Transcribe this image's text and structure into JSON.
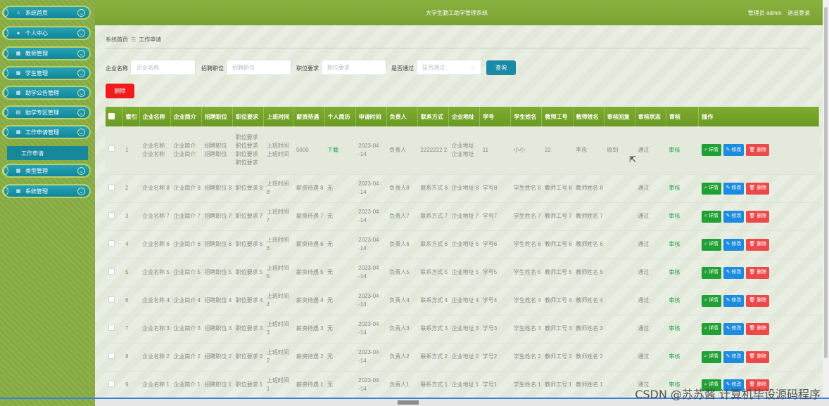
{
  "app": {
    "title": "大学生勤工助学管理系统",
    "user": "管理员 admin",
    "logout": "退出登录"
  },
  "sidebar": {
    "items": [
      {
        "label": "系统首页",
        "icon": "home-icon"
      },
      {
        "label": "个人中心",
        "icon": "user-icon"
      },
      {
        "label": "教师管理",
        "icon": "grid-icon"
      },
      {
        "label": "学生管理",
        "icon": "grid-icon"
      },
      {
        "label": "助学公告管理",
        "icon": "grid-icon"
      },
      {
        "label": "助学专区管理",
        "icon": "calendar-icon"
      },
      {
        "label": "工作申请管理",
        "icon": "grid-icon"
      },
      {
        "label": "类型管理",
        "icon": "grid-icon"
      },
      {
        "label": "系统管理",
        "icon": "grid-icon"
      }
    ],
    "sub_item": "工作申请"
  },
  "breadcrumb": {
    "home": "系统首页",
    "sep": "☰",
    "current": "工作申请"
  },
  "search": {
    "company_label": "企业名称",
    "company_placeholder": "企业名称",
    "job_label": "招聘职位",
    "job_placeholder": "招聘职位",
    "req_label": "职位要求",
    "req_placeholder": "职位要求",
    "pass_label": "是否通过",
    "pass_placeholder": "是否通过",
    "query_button": "查询"
  },
  "toolbar": {
    "delete_button": "删除"
  },
  "table": {
    "headers": [
      "",
      "索引",
      "企业名称",
      "企业简介",
      "招聘职位",
      "职位要求",
      "上班时间",
      "薪资待遇",
      "个人简历",
      "申请时间",
      "负责人",
      "联系方式",
      "企业地址",
      "学号",
      "学生姓名",
      "教师工号",
      "教师姓名",
      "审核回复",
      "审核状态",
      "审核",
      "操作"
    ],
    "ops": {
      "detail": "详情",
      "edit": "修改",
      "delete": "删除"
    },
    "rows": [
      {
        "idx": "1",
        "company": "企业名称 企业名称",
        "intro": "企业简介 企业简介",
        "job": "招聘职位 招聘职位",
        "req": "职位要求 职位要求 职位要求 职位要求",
        "time": "上班时间 上班时间",
        "salary": "5000",
        "resume": "下载",
        "apply": "2023-04 -14",
        "manager": "负责人",
        "contact": "2222222 2",
        "addr": "企业地址 企业地址",
        "sno": "11",
        "sname": "小小",
        "tno": "22",
        "tname": "李忠",
        "reply": "收到",
        "status": "通过",
        "audit": "审核"
      },
      {
        "idx": "2",
        "company": "企业名称 8",
        "intro": "企业简介 8",
        "job": "招聘职位 8",
        "req": "职位要求 8",
        "time": "上班时间 8",
        "salary": "薪资待遇 8",
        "resume": "无",
        "apply": "2023-04 -14",
        "manager": "负责人8",
        "contact": "联系方式 8",
        "addr": "企业地址 8",
        "sno": "学号8",
        "sname": "学生姓名 8",
        "tno": "教师工号 8",
        "tname": "教师姓名 8",
        "reply": "",
        "status": "通过",
        "audit": "审核"
      },
      {
        "idx": "3",
        "company": "企业名称 7",
        "intro": "企业简介 7",
        "job": "招聘职位 7",
        "req": "职位要求 7",
        "time": "上班时间 7",
        "salary": "薪资待遇 7",
        "resume": "无",
        "apply": "2023-04 -14",
        "manager": "负责人7",
        "contact": "联系方式 7",
        "addr": "企业地址 7",
        "sno": "学号7",
        "sname": "学生姓名 7",
        "tno": "教师工号 7",
        "tname": "教师姓名 7",
        "reply": "",
        "status": "通过",
        "audit": "审核"
      },
      {
        "idx": "4",
        "company": "企业名称 6",
        "intro": "企业简介 6",
        "job": "招聘职位 6",
        "req": "职位要求 6",
        "time": "上班时间 6",
        "salary": "薪资待遇 6",
        "resume": "无",
        "apply": "2023-04 -14",
        "manager": "负责人6",
        "contact": "联系方式 6",
        "addr": "企业地址 6",
        "sno": "学号6",
        "sname": "学生姓名 6",
        "tno": "教师工号 6",
        "tname": "教师姓名 6",
        "reply": "",
        "status": "通过",
        "audit": "审核"
      },
      {
        "idx": "5",
        "company": "企业名称 5",
        "intro": "企业简介 5",
        "job": "招聘职位 5",
        "req": "职位要求 5",
        "time": "上班时间 5",
        "salary": "薪资待遇 5",
        "resume": "无",
        "apply": "2023-04 -14",
        "manager": "负责人5",
        "contact": "联系方式 5",
        "addr": "企业地址 5",
        "sno": "学号5",
        "sname": "学生姓名 5",
        "tno": "教师工号 5",
        "tname": "教师姓名 5",
        "reply": "",
        "status": "通过",
        "audit": "审核"
      },
      {
        "idx": "6",
        "company": "企业名称 4",
        "intro": "企业简介 4",
        "job": "招聘职位 4",
        "req": "职位要求 4",
        "time": "上班时间 4",
        "salary": "薪资待遇 4",
        "resume": "无",
        "apply": "2023-04 -14",
        "manager": "负责人4",
        "contact": "联系方式 4",
        "addr": "企业地址 4",
        "sno": "学号4",
        "sname": "学生姓名 4",
        "tno": "教师工号 4",
        "tname": "教师姓名 4",
        "reply": "",
        "status": "通过",
        "audit": "审核"
      },
      {
        "idx": "7",
        "company": "企业名称 3",
        "intro": "企业简介 3",
        "job": "招聘职位 3",
        "req": "职位要求 3",
        "time": "上班时间 3",
        "salary": "薪资待遇 3",
        "resume": "无",
        "apply": "2023-04 -14",
        "manager": "负责人3",
        "contact": "联系方式 3",
        "addr": "企业地址 3",
        "sno": "学号3",
        "sname": "学生姓名 3",
        "tno": "教师工号 3",
        "tname": "教师姓名 3",
        "reply": "",
        "status": "通过",
        "audit": "审核"
      },
      {
        "idx": "8",
        "company": "企业名称 2",
        "intro": "企业简介 2",
        "job": "招聘职位 2",
        "req": "职位要求 2",
        "time": "上班时间 2",
        "salary": "薪资待遇 2",
        "resume": "无",
        "apply": "2023-04 -14",
        "manager": "负责人2",
        "contact": "联系方式 2",
        "addr": "企业地址 2",
        "sno": "学号2",
        "sname": "学生姓名 2",
        "tno": "教师工号 2",
        "tname": "教师姓名 2",
        "reply": "",
        "status": "通过",
        "audit": "审核"
      },
      {
        "idx": "9",
        "company": "企业名称 1",
        "intro": "企业简介 1",
        "job": "招聘职位 1",
        "req": "职位要求 1",
        "time": "上班时间 1",
        "salary": "薪资待遇 1",
        "resume": "无",
        "apply": "2023-04 -14",
        "manager": "负责人1",
        "contact": "联系方式 1",
        "addr": "企业地址 1",
        "sno": "学号1",
        "sname": "学生姓名 1",
        "tno": "教师工号 1",
        "tname": "教师姓名 1",
        "reply": "",
        "status": "通过",
        "audit": "审核"
      }
    ]
  },
  "watermark": "CSDN @苏苏酱 计算机毕设源码程序"
}
